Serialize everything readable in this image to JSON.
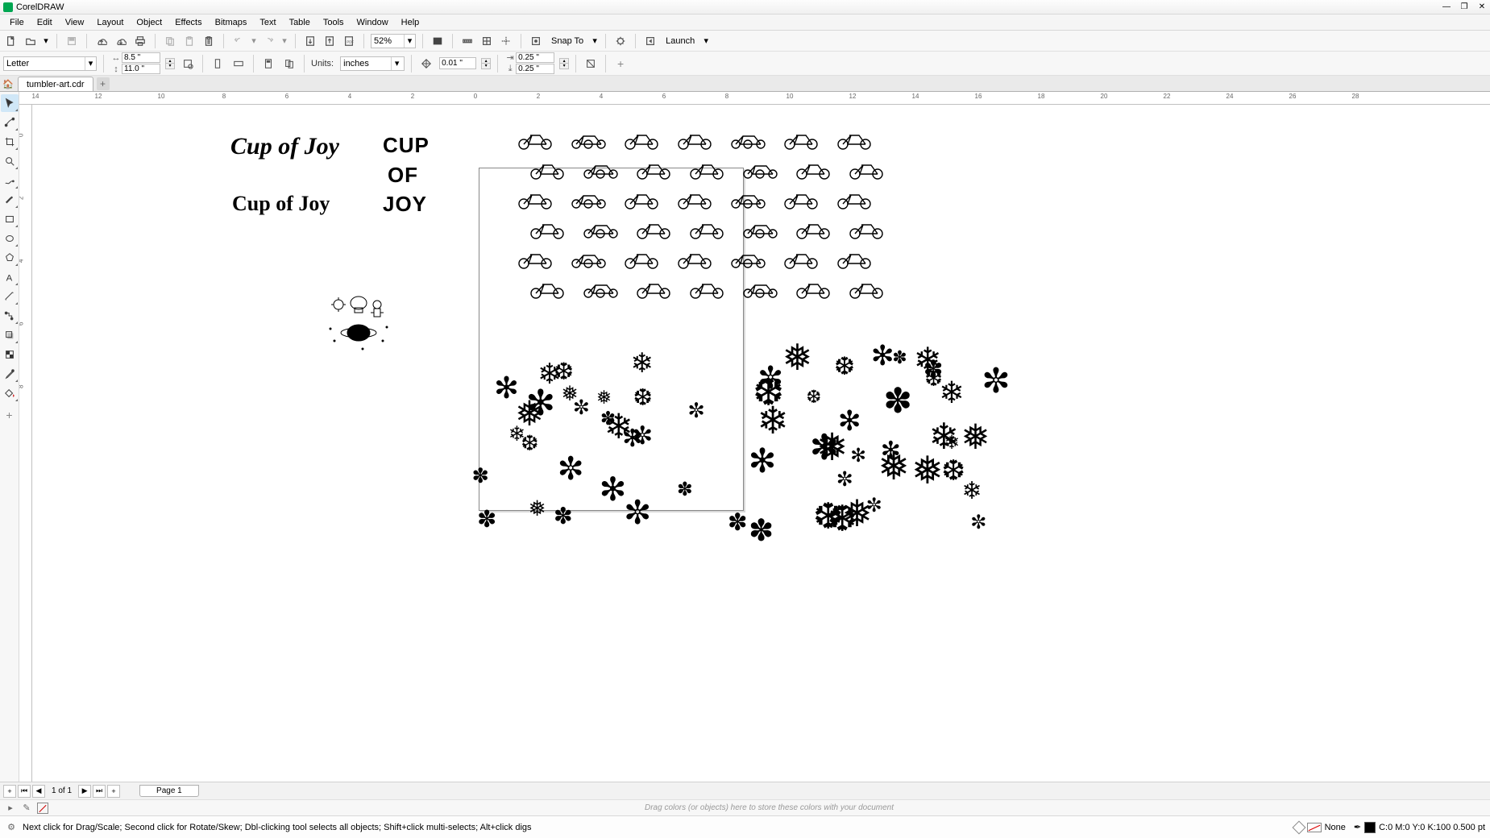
{
  "app": {
    "title": "CorelDRAW"
  },
  "menu": [
    "File",
    "Edit",
    "View",
    "Layout",
    "Object",
    "Effects",
    "Bitmaps",
    "Text",
    "Table",
    "Tools",
    "Window",
    "Help"
  ],
  "toolbar": {
    "zoom_value": "52%",
    "snap_label": "Snap To",
    "launch_label": "Launch"
  },
  "property_bar": {
    "page_preset": "Letter",
    "page_w": "8.5 \"",
    "page_h": "11.0 \"",
    "units_label": "Units:",
    "units_value": "inches",
    "nudge_value": "0.01 \"",
    "dup_x": "0.25 \"",
    "dup_y": "0.25 \""
  },
  "doc_tab": {
    "name": "tumbler-art.cdr"
  },
  "ruler_h_ticks": [
    "14",
    "12",
    "10",
    "8",
    "6",
    "4",
    "2",
    "0",
    "2",
    "4",
    "6",
    "8",
    "10",
    "12",
    "14",
    "16",
    "18",
    "20",
    "22",
    "24",
    "26",
    "28"
  ],
  "ruler_v_ticks": [
    "0",
    "2",
    "4",
    "6",
    "8"
  ],
  "artwork": {
    "script_text": "Cup of Joy",
    "serif_text": "Cup of Joy",
    "block_text_1": "CUP",
    "block_text_2": "OF",
    "block_text_3": "JOY"
  },
  "page_nav": {
    "current": "1",
    "of_label": "of",
    "total": "1",
    "page_tab": "Page 1"
  },
  "color_tray": {
    "hint": "Drag colors (or objects) here to store these colors with your document"
  },
  "status": {
    "hint": "Next click for Drag/Scale; Second click for Rotate/Skew; Dbl-clicking tool selects all objects; Shift+click multi-selects; Alt+click digs",
    "fill_label": "None",
    "outline_info": "C:0 M:0 Y:0 K:100 0.500 pt"
  }
}
